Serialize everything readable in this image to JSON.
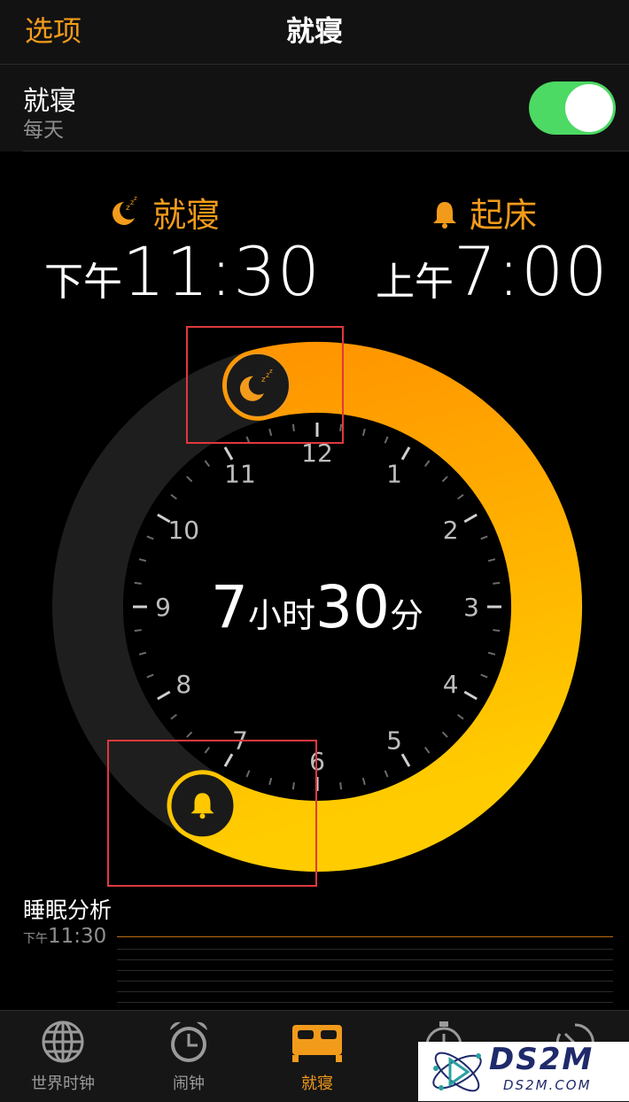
{
  "nav": {
    "left": "选项",
    "title": "就寝"
  },
  "section": {
    "title": "就寝",
    "subtitle": "每天",
    "toggle_on": true
  },
  "bedtime": {
    "label": "就寝",
    "ampm": "下午",
    "time": "11:30"
  },
  "wake": {
    "label": "起床",
    "ampm": "上午",
    "time": "7:00"
  },
  "clock": {
    "numbers": [
      "12",
      "1",
      "2",
      "3",
      "4",
      "5",
      "6",
      "7",
      "8",
      "9",
      "10",
      "11"
    ],
    "duration": {
      "hours": "7",
      "hours_unit": "小时",
      "minutes": "30",
      "minutes_unit": "分"
    },
    "start_hour": 11.5,
    "end_hour": 7.0
  },
  "analysis": {
    "title": "睡眠分析",
    "ampm": "下午",
    "time": "11:30"
  },
  "tabs": [
    {
      "label": "世界时钟",
      "icon": "globe-icon",
      "active": false
    },
    {
      "label": "闹钟",
      "icon": "alarm-clock-icon",
      "active": false
    },
    {
      "label": "就寝",
      "icon": "bed-icon",
      "active": true
    },
    {
      "label": "",
      "icon": "stopwatch-icon",
      "active": false
    },
    {
      "label": "",
      "icon": "timer-icon",
      "active": false
    }
  ],
  "watermark": {
    "big": "DS2M",
    "small": "DS2M.COM"
  },
  "colors": {
    "accent": "#f29b1b",
    "toggle": "#4cd964",
    "ring_start": "#ff9500",
    "ring_end": "#ffcc00",
    "highlight": "#e0383e"
  }
}
